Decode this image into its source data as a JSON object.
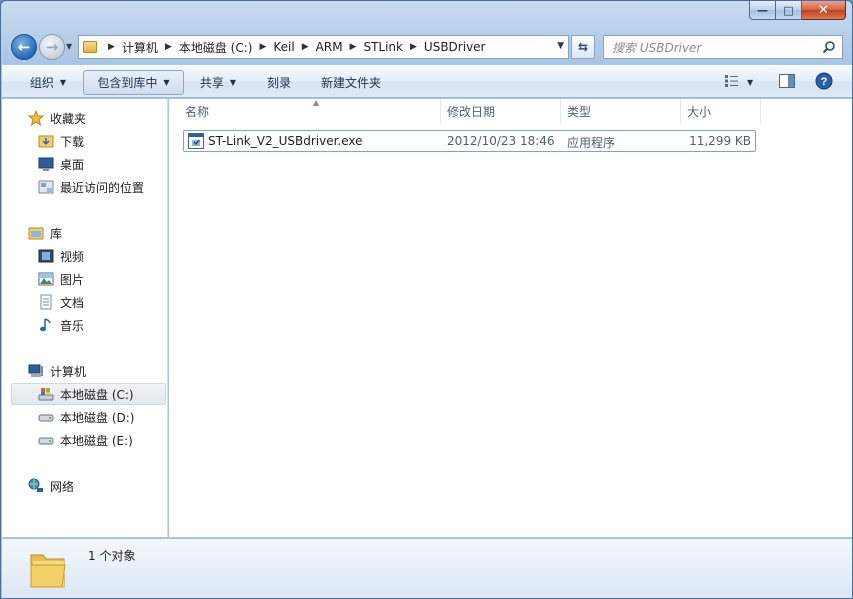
{
  "window": {
    "caption_buttons": {
      "minimize": "—",
      "maximize": "□",
      "close": "✕"
    }
  },
  "nav": {
    "back_icon": "back-arrow-icon",
    "forward_icon": "forward-arrow-icon",
    "breadcrumb": [
      "计算机",
      "本地磁盘 (C:)",
      "Keil",
      "ARM",
      "STLink",
      "USBDriver"
    ],
    "search_placeholder": "搜索 USBDriver"
  },
  "toolbar": {
    "organize": "组织",
    "include_in_library": "包含到库中",
    "share": "共享",
    "burn": "刻录",
    "new_folder": "新建文件夹"
  },
  "sidebar": {
    "favorites": {
      "label": "收藏夹",
      "items": [
        {
          "label": "下载",
          "icon": "downloads-folder-icon"
        },
        {
          "label": "桌面",
          "icon": "desktop-icon"
        },
        {
          "label": "最近访问的位置",
          "icon": "recent-places-icon"
        }
      ]
    },
    "libraries": {
      "label": "库",
      "items": [
        {
          "label": "视频",
          "icon": "video-library-icon"
        },
        {
          "label": "图片",
          "icon": "pictures-library-icon"
        },
        {
          "label": "文档",
          "icon": "documents-library-icon"
        },
        {
          "label": "音乐",
          "icon": "music-library-icon"
        }
      ]
    },
    "computer": {
      "label": "计算机",
      "items": [
        {
          "label": "本地磁盘 (C:)",
          "icon": "system-drive-icon",
          "selected": true
        },
        {
          "label": "本地磁盘 (D:)",
          "icon": "drive-icon"
        },
        {
          "label": "本地磁盘 (E:)",
          "icon": "drive-icon"
        }
      ]
    },
    "network": {
      "label": "网络"
    }
  },
  "file_list": {
    "columns": [
      "名称",
      "修改日期",
      "类型",
      "大小"
    ],
    "rows": [
      {
        "name": "ST-Link_V2_USBdriver.exe",
        "modified": "2012/10/23 18:46",
        "type": "应用程序",
        "size": "11,299 KB",
        "icon": "exe-file-icon"
      }
    ]
  },
  "details": {
    "summary": "1 个对象"
  },
  "colors": {
    "accent": "#2a67b6",
    "selection_border": "#7da2ce"
  }
}
